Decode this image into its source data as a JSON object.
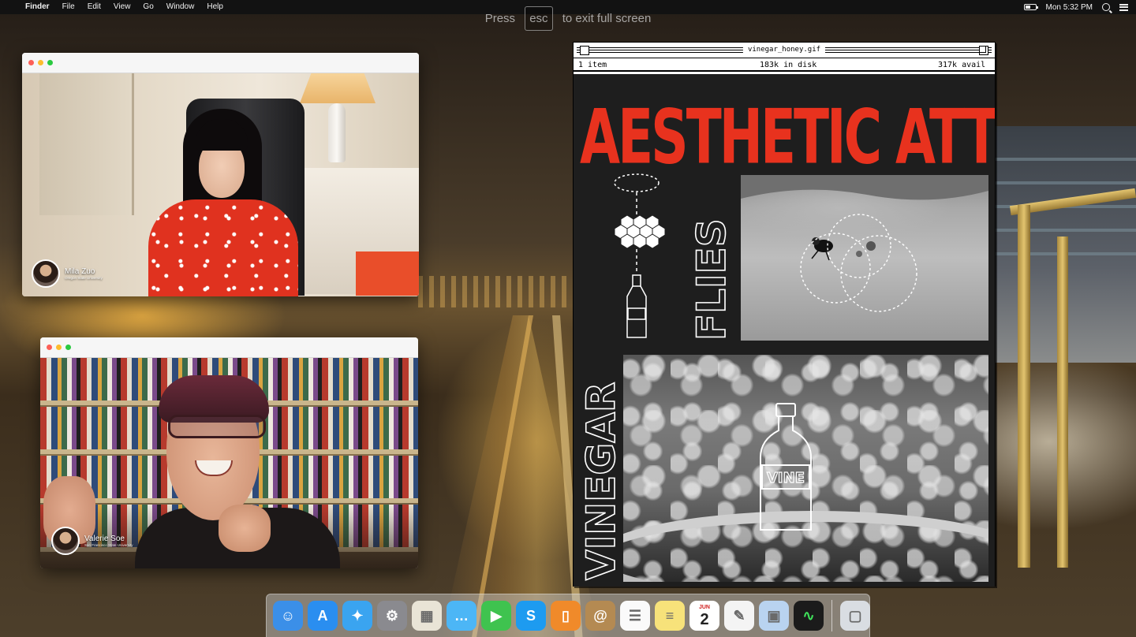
{
  "menubar": {
    "apple_symbol": "",
    "app_name": "Finder",
    "menus": [
      "File",
      "Edit",
      "View",
      "Go",
      "Window",
      "Help"
    ],
    "clock": "Mon 5:32 PM"
  },
  "fullscreen_hint": {
    "before": "Press",
    "key": "esc",
    "after": "to exit full screen"
  },
  "video_call": {
    "participants": [
      {
        "name": "Mila Zuo",
        "affiliation": "Oregon State University"
      },
      {
        "name": "Valerie Soe",
        "affiliation": "San Francisco State University"
      }
    ]
  },
  "gif_window": {
    "title": "vinegar_honey.gif",
    "item_count": "1 item",
    "disk_used": "183k in disk",
    "disk_avail": "317k avail",
    "art": {
      "headline": "AESTHETIC ATTRACTION",
      "side_labels": [
        "FLIES",
        "VINEGAR"
      ],
      "bottle_label": "VINE",
      "colors": {
        "headline": "#e8321e",
        "background": "#1e1e1e",
        "line_art": "#ffffff"
      }
    }
  },
  "dock": {
    "items": [
      {
        "name": "Finder",
        "icon": "finder-icon",
        "color": "#3b8fe8"
      },
      {
        "name": "App Store",
        "icon": "app-store-icon",
        "color": "#2a8ef0"
      },
      {
        "name": "Safari",
        "icon": "safari-icon",
        "color": "#3aa4f0"
      },
      {
        "name": "System Preferences",
        "icon": "gear-icon",
        "color": "#8a8a8f"
      },
      {
        "name": "Preview",
        "icon": "preview-icon",
        "color": "#e9e4d6"
      },
      {
        "name": "Messages",
        "icon": "messages-icon",
        "color": "#4cb6f6"
      },
      {
        "name": "FaceTime",
        "icon": "facetime-icon",
        "color": "#3fc34f"
      },
      {
        "name": "Skype",
        "icon": "skype-icon",
        "color": "#1d9bf0"
      },
      {
        "name": "iBooks",
        "icon": "books-icon",
        "color": "#f08a2a"
      },
      {
        "name": "Contacts",
        "icon": "contacts-icon",
        "color": "#b48a52"
      },
      {
        "name": "Reminders",
        "icon": "reminders-icon",
        "color": "#fafafa"
      },
      {
        "name": "Notes",
        "icon": "notes-icon",
        "color": "#f7e27a"
      },
      {
        "name": "Calendar",
        "icon": "calendar-icon",
        "color": "#ffffff",
        "month": "JUN",
        "day": "2"
      },
      {
        "name": "TextEdit",
        "icon": "textedit-icon",
        "color": "#f4f4f4"
      },
      {
        "name": "Preview Image",
        "icon": "photo-preview-icon",
        "color": "#b9d3f0"
      },
      {
        "name": "Activity Monitor",
        "icon": "activity-monitor-icon",
        "color": "#1b1b1b"
      },
      {
        "name": "Trash",
        "icon": "trash-icon",
        "color": "#d9dde2"
      }
    ]
  }
}
